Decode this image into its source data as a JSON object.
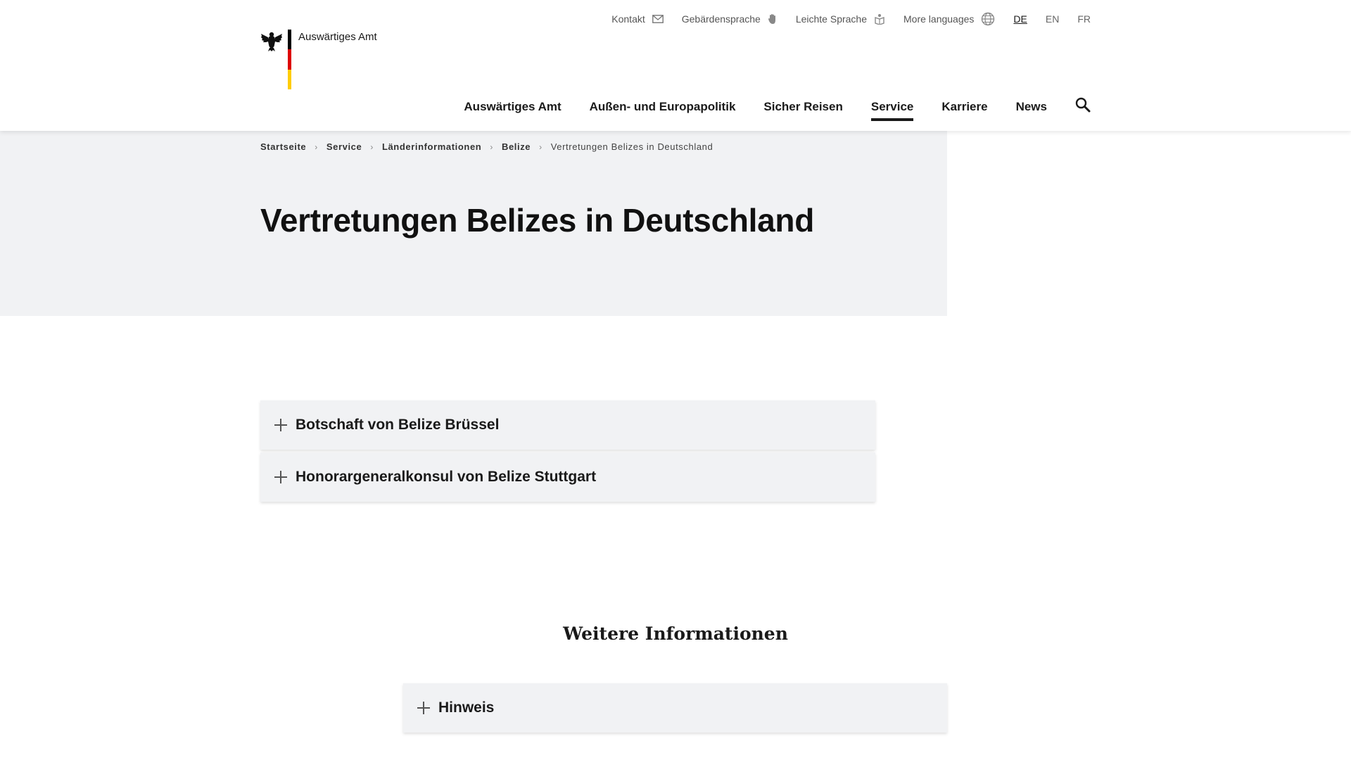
{
  "brand": {
    "name": "Auswärtiges Amt",
    "flag_colors": [
      "#000000",
      "#dd0000",
      "#ffcc00"
    ]
  },
  "meta_nav": {
    "items": [
      {
        "label": "Kontakt",
        "icon": "mail-icon"
      },
      {
        "label": "Gebärdensprache",
        "icon": "hand-icon"
      },
      {
        "label": "Leichte Sprache",
        "icon": "easy-language-icon"
      },
      {
        "label": "More languages",
        "icon": "globe-icon"
      }
    ],
    "languages": [
      "DE",
      "EN",
      "FR"
    ],
    "active_language": "DE"
  },
  "main_nav": {
    "items": [
      "Auswärtiges Amt",
      "Außen- und Europapolitik",
      "Sicher Reisen",
      "Service",
      "Karriere",
      "News"
    ],
    "active": "Service",
    "search_icon": "search-icon"
  },
  "breadcrumb": [
    "Startseite",
    "Service",
    "Länderinformationen",
    "Belize",
    "Vertretungen Belizes in Deutschland"
  ],
  "page": {
    "title": "Vertretungen Belizes in Deutschland"
  },
  "accordions": [
    {
      "label": "Botschaft von Belize Brüssel"
    },
    {
      "label": "Honorargeneralkonsul von Belize Stuttgart"
    }
  ],
  "more_info": {
    "heading": "Weitere Informationen",
    "accordions": [
      {
        "label": "Hinweis"
      }
    ]
  }
}
